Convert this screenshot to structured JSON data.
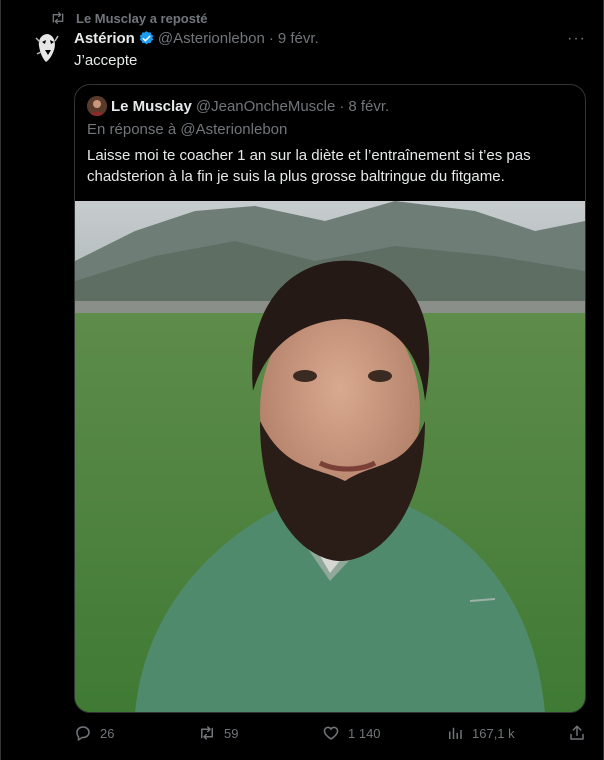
{
  "repost": {
    "icon": "repost-icon",
    "text": "Le Musclay a reposté"
  },
  "tweet": {
    "author_name": "Astérion",
    "handle": "@Asterionlebon",
    "separator": "·",
    "date": "9 févr.",
    "text": "J’accepte"
  },
  "quote": {
    "author_name": "Le Musclay",
    "handle": "@JeanOncheMuscle",
    "separator": "·",
    "date": "8 févr.",
    "reply_to": "En réponse à @Asterionlebon",
    "text": "Laisse moi te coacher 1 an sur la diète et l’entraînement si t’es pas chadsterion à la fin je suis la plus grosse baltringue du fitgame."
  },
  "actions": {
    "replies": "26",
    "reposts": "59",
    "likes": "1 140",
    "views": "167,1 k"
  },
  "colors": {
    "accent": "#1d9bf0",
    "muted": "#71767b",
    "text": "#e7e9ea",
    "border": "#2f3336",
    "background": "#000000"
  }
}
